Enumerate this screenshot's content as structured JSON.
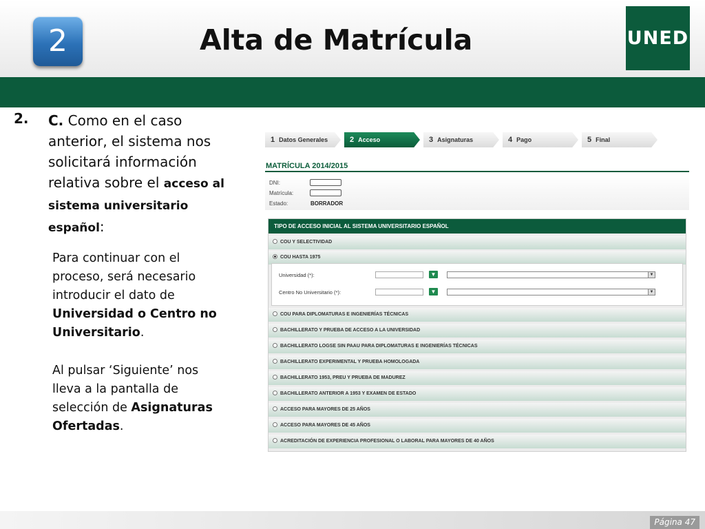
{
  "header": {
    "badge_number": "2",
    "title": "Alta de Matrícula",
    "logo_text": "UNED"
  },
  "left": {
    "step_number": "2.",
    "step_letter": "C.",
    "step_text_1": " Como en el caso anterior, el sistema nos solicitará información relativa sobre el ",
    "step_bold": "acceso al sistema universitario español",
    "step_text_2": ":",
    "info_1_a": "Para continuar con el proceso, será necesario introducir el dato de ",
    "info_1_bold": "Universidad o Centro no Universitario",
    "info_1_b": ".",
    "info_2_a": "Al pulsar ‘Siguiente’ nos lleva a la pantalla de selección de ",
    "info_2_bold": "Asignaturas Ofertadas",
    "info_2_b": "."
  },
  "wizard": {
    "steps": [
      {
        "num": "1",
        "label": "Datos Generales",
        "active": false
      },
      {
        "num": "2",
        "label": "Acceso",
        "active": true
      },
      {
        "num": "3",
        "label": "Asignaturas",
        "active": false
      },
      {
        "num": "4",
        "label": "Pago",
        "active": false
      },
      {
        "num": "5",
        "label": "Final",
        "active": false
      }
    ],
    "matricula_title": "MATRÍCULA 2014/2015",
    "fields": {
      "dni_label": "DNI:",
      "matricula_label": "Matrícula:",
      "estado_label": "Estado:",
      "estado_value": "BORRADOR"
    },
    "panel_title": "TIPO DE ACCESO INICIAL AL SISTEMA UNIVERSITARIO ESPAÑOL",
    "options": [
      "COU Y SELECTIVIDAD",
      "COU HASTA 1975",
      "COU PARA DIPLOMATURAS E INGENIERÍAS TÉCNICAS",
      "BACHILLERATO Y PRUEBA DE ACCESO A LA UNIVERSIDAD",
      "BACHILLERATO LOGSE SIN PAAU PARA DIPLOMATURAS E INGENIERÍAS TÉCNICAS",
      "BACHILLERATO EXPERIMENTAL Y PRUEBA HOMOLOGADA",
      "BACHILLERATO 1953, PREU Y PRUEBA DE MADUREZ",
      "BACHILLERATO ANTERIOR A 1953 Y EXAMEN DE ESTADO",
      "ACCESO PARA MAYORES DE 25 AÑOS",
      "ACCESO PARA MAYORES DE 45 AÑOS",
      "ACREDITACIÓN DE EXPERIENCIA PROFESIONAL O LABORAL PARA MAYORES DE 40 AÑOS"
    ],
    "selected_option": "COU HASTA 1975",
    "sub_fields": {
      "universidad_label": "Universidad (*):",
      "centro_label": "Centro No Universitario (*):",
      "filter_icon": "filter-funnel-icon",
      "dropdown_icon": "chevron-down-icon"
    }
  },
  "footer": {
    "page_label": "Página 47"
  }
}
